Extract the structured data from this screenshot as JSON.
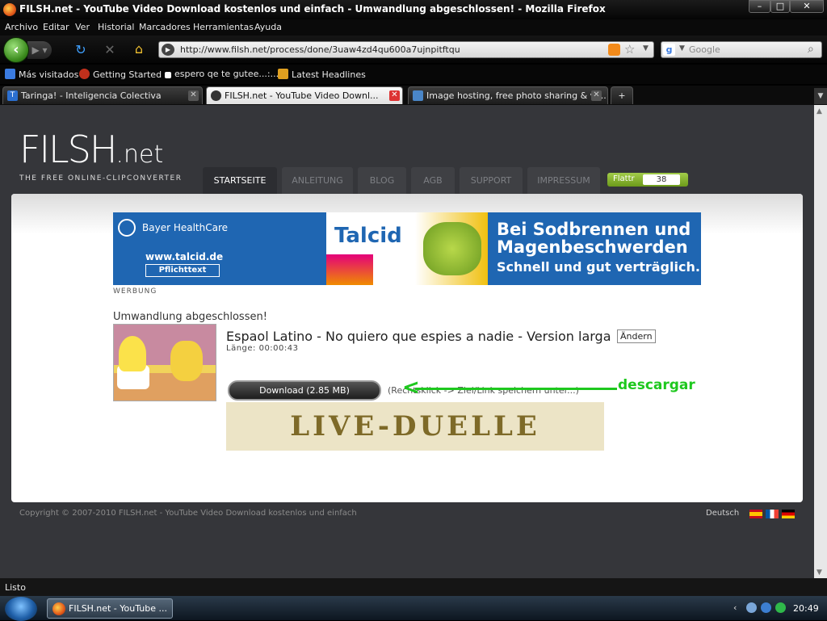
{
  "window": {
    "title": "FILSH.net - YouTube Video Download kostenlos und einfach - Umwandlung abgeschlossen! - Mozilla Firefox",
    "min": "–",
    "max": "□",
    "close": "✕"
  },
  "menu": [
    "Archivo",
    "Editar",
    "Ver",
    "Historial",
    "Marcadores",
    "Herramientas",
    "Ayuda"
  ],
  "nav": {
    "url": "http://www.filsh.net/process/done/3uaw4zd4qu600a7ujnpitftqu",
    "search_placeholder": "Google"
  },
  "bookmarks": [
    "Más visitados",
    "Getting Started",
    "espero qe te gutee...:...",
    "Latest Headlines"
  ],
  "tabs": [
    {
      "label": "Taringa! - Inteligencia Colectiva"
    },
    {
      "label": "FILSH.net - YouTube Video Downl..."
    },
    {
      "label": "Image hosting, free photo sharing & vi..."
    }
  ],
  "tab_add": "+",
  "site": {
    "logo_main": "FILSH",
    "logo_net": ".net",
    "tagline": "THE FREE ONLINE-CLIPCONVERTER",
    "nav": [
      "STARTSEITE",
      "ANLEITUNG",
      "BLOG",
      "AGB",
      "SUPPORT",
      "IMPRESSUM"
    ],
    "flattr_label": "Flattr",
    "flattr_count": "38"
  },
  "ad": {
    "sponsor": "Bayer HealthCare",
    "url": "www.talcid.de",
    "pflicht": "Pflichttext",
    "brand": "Talcid",
    "headline_1": "Bei Sodbrennen und",
    "headline_2": "Magenbeschwerden",
    "sub": "Schnell und gut verträglich.",
    "label": "WERBUNG"
  },
  "result": {
    "status": "Umwandlung abgeschlossen!",
    "title": "Espaol Latino - No quiero que espies a nadie - Version larga",
    "edit_label": "Ändern",
    "length": "Länge: 00:00:43",
    "download_label": "Download (2.85 MB)",
    "hint": "(Rechtsklick -> Ziel/Link speichern unter...)",
    "annotation": "descargar",
    "promo": "LIVE-DUELLE"
  },
  "footer": {
    "copyright": "Copyright © 2007-2010 FILSH.net - YouTube Video Download kostenlos und einfach",
    "language": "Deutsch"
  },
  "status": "Listo",
  "taskbar": {
    "item": "FILSH.net - YouTube ...",
    "clock": "20:49"
  }
}
